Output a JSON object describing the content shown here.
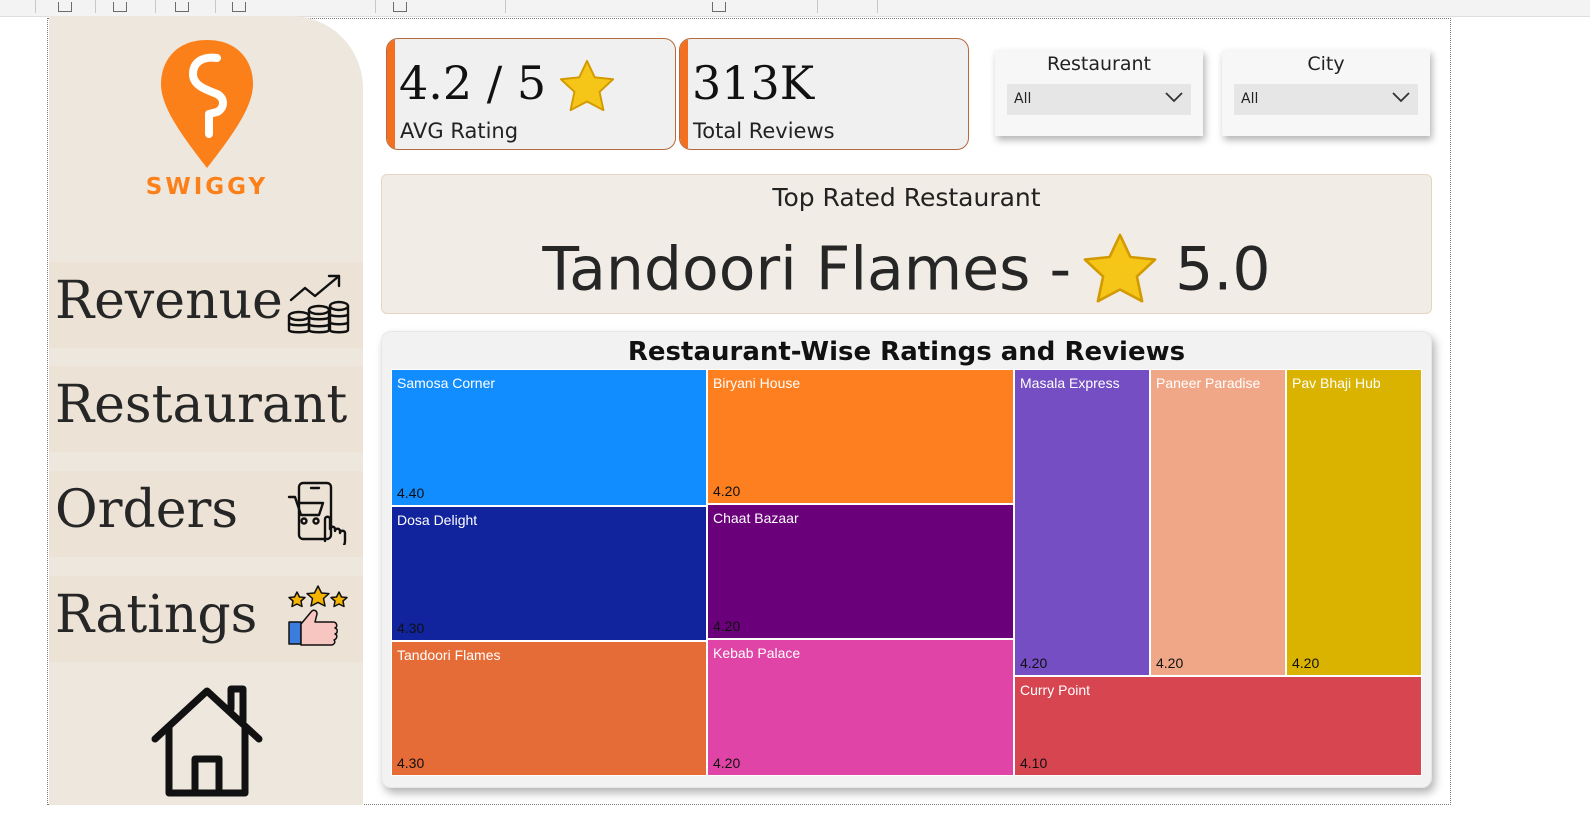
{
  "brand": {
    "name": "SWIGGY",
    "color": "#fc8019"
  },
  "nav": {
    "items": [
      {
        "label": "Revenue",
        "icon": "revenue-coins-icon"
      },
      {
        "label": "Restaurant",
        "icon": ""
      },
      {
        "label": "Orders",
        "icon": "mobile-order-icon"
      },
      {
        "label": "Ratings",
        "icon": "ratings-thumbs-up-icon"
      }
    ],
    "home_icon": "home-icon"
  },
  "kpis": [
    {
      "value": "4.2 / 5",
      "label": "AVG Rating",
      "icon": "star-icon"
    },
    {
      "value": "313K",
      "label": "Total Reviews"
    }
  ],
  "filters": [
    {
      "title": "Restaurant",
      "selected": "All"
    },
    {
      "title": "City",
      "selected": "All"
    }
  ],
  "top_rated": {
    "title": "Top Rated Restaurant",
    "name": "Tandoori Flames -",
    "rating": "5.0",
    "icon": "star-icon"
  },
  "colors": {
    "accent": "#f37021",
    "sidebar": "#ede7de"
  },
  "chart_data": {
    "type": "treemap",
    "title": "Restaurant-Wise Ratings and Reviews",
    "items": [
      {
        "name": "Samosa Corner",
        "rating": "4.40",
        "color": "#118dff"
      },
      {
        "name": "Dosa Delight",
        "rating": "4.30",
        "color": "#12239e"
      },
      {
        "name": "Tandoori Flames",
        "rating": "4.30",
        "color": "#e66c37"
      },
      {
        "name": "Biryani House",
        "rating": "4.20",
        "color": "#fd7f1f"
      },
      {
        "name": "Chaat Bazaar",
        "rating": "4.20",
        "color": "#6b007b"
      },
      {
        "name": "Kebab Palace",
        "rating": "4.20",
        "color": "#e044a7"
      },
      {
        "name": "Masala Express",
        "rating": "4.20",
        "color": "#744ec2"
      },
      {
        "name": "Paneer Paradise",
        "rating": "4.20",
        "color": "#efa788"
      },
      {
        "name": "Pav Bhaji Hub",
        "rating": "4.20",
        "color": "#d9b300"
      },
      {
        "name": "Curry Point",
        "rating": "4.10",
        "color": "#d64550"
      }
    ]
  }
}
